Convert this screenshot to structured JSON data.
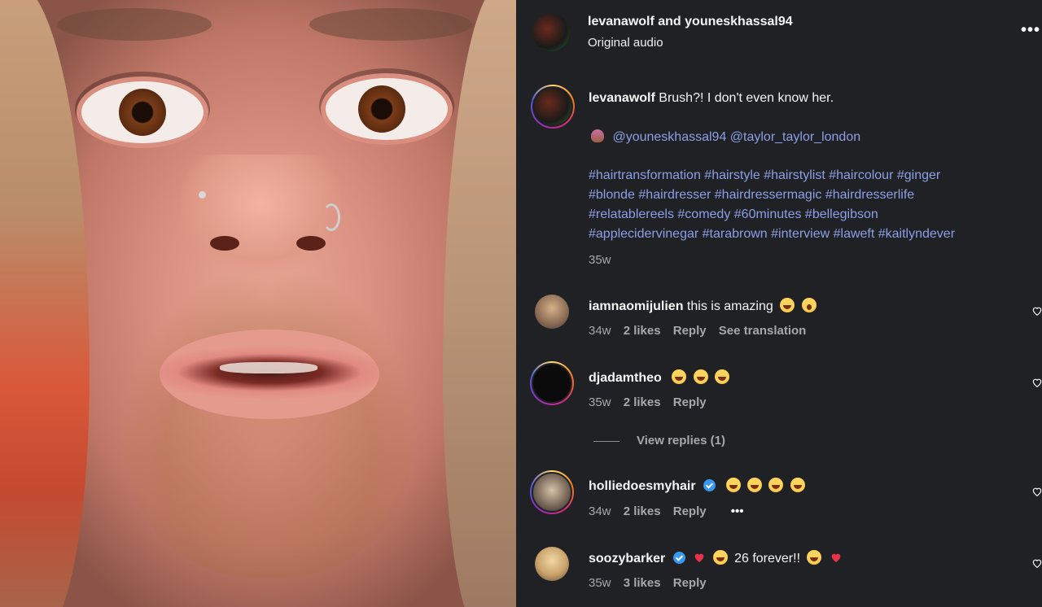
{
  "header": {
    "title": "levanawolf and youneskhassal94",
    "subtitle": "Original audio",
    "more_label": "•••"
  },
  "caption": {
    "username": "levanawolf",
    "text": "Brush?! I don't even know her.",
    "mentions": "@youneskhassal94 @taylor_taylor_london",
    "hashtags": [
      "#hairtransformation #hairstyle #hairstylist #haircolour #ginger",
      "#blonde #hairdresser #hairdressermagic #hairdresserlife",
      "#relatablereels #comedy #60minutes #bellegibson",
      "#applecidervinegar #tarabrown #interview #laweft #kaitlyndever"
    ],
    "time": "35w"
  },
  "comments": [
    {
      "username": "iamnaomijulien",
      "text": "this is amazing",
      "time": "34w",
      "likes": "2 likes",
      "reply": "Reply",
      "extra": "See translation"
    },
    {
      "username": "djadamtheo",
      "text": "",
      "time": "35w",
      "likes": "2 likes",
      "reply": "Reply"
    },
    {
      "username": "holliedoesmyhair",
      "text": "",
      "time": "34w",
      "likes": "2 likes",
      "reply": "Reply",
      "extra": "•••"
    },
    {
      "username": "soozybarker",
      "text": "26 forever!!",
      "time": "35w",
      "likes": "3 likes",
      "reply": "Reply"
    }
  ],
  "view_replies": "View replies (1)",
  "colors": {
    "panel_bg": "#202124",
    "link": "#8c9fe6",
    "muted": "#a8a8a8",
    "verified": "#3897f0"
  }
}
